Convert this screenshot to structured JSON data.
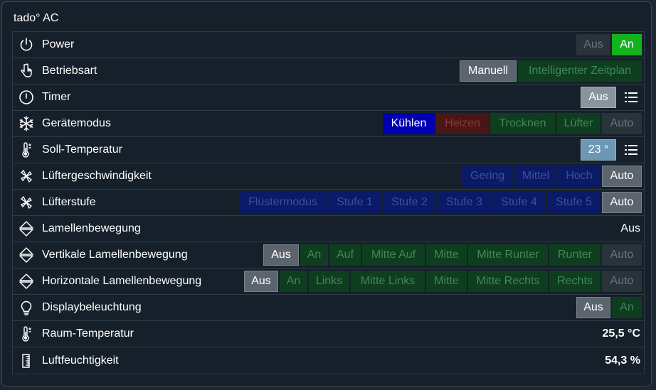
{
  "panel": {
    "title": "tado° AC"
  },
  "rows": {
    "power": {
      "label": "Power",
      "icon": "power-icon",
      "buttons": [
        "Aus",
        "An"
      ]
    },
    "betriebsart": {
      "label": "Betriebsart",
      "icon": "hand-pointer-icon",
      "buttons": [
        "Manuell",
        "Intelligenter Zeitplan"
      ]
    },
    "timer": {
      "label": "Timer",
      "icon": "clock-icon",
      "buttons": [
        "Aus"
      ]
    },
    "geraetemodus": {
      "label": "Gerätemodus",
      "icon": "snowflake-icon",
      "buttons": [
        "Kühlen",
        "Heizen",
        "Trocknen",
        "Lüfter",
        "Auto"
      ]
    },
    "soll_temperatur": {
      "label": "Soll-Temperatur",
      "icon": "thermometer-icon",
      "buttons": [
        "23 °"
      ]
    },
    "luftergeschwindigkeit": {
      "label": "Lüftergeschwindigkeit",
      "icon": "fan-icon",
      "buttons": [
        "Gering",
        "Mittel",
        "Hoch",
        "Auto"
      ]
    },
    "lufterstufe": {
      "label": "Lüfterstufe",
      "icon": "fan-icon",
      "buttons": [
        "Flüstermodus",
        "Stufe 1",
        "Stufe 2",
        "Stufe 3",
        "Stufe 4",
        "Stufe 5",
        "Auto"
      ]
    },
    "lamellenbewegung": {
      "label": "Lamellenbewegung",
      "icon": "swing-icon",
      "value": "Aus"
    },
    "vertikale": {
      "label": "Vertikale Lamellenbewegung",
      "icon": "swing-icon",
      "buttons": [
        "Aus",
        "An",
        "Auf",
        "Mitte Auf",
        "Mitte",
        "Mitte Runter",
        "Runter",
        "Auto"
      ]
    },
    "horizontale": {
      "label": "Horizontale Lamellenbewegung",
      "icon": "swing-icon",
      "buttons": [
        "Aus",
        "An",
        "Links",
        "Mitte Links",
        "Mitte",
        "Mitte Rechts",
        "Rechts",
        "Auto"
      ]
    },
    "displaybeleuchtung": {
      "label": "Displaybeleuchtung",
      "icon": "lightbulb-icon",
      "buttons": [
        "Aus",
        "An"
      ]
    },
    "raum_temperatur": {
      "label": "Raum-Temperatur",
      "icon": "thermometer-icon",
      "value": "25,5 °C"
    },
    "luftfeuchtigkeit": {
      "label": "Luftfeuchtigkeit",
      "icon": "humidity-icon",
      "value": "54,3 %"
    }
  },
  "colors": {
    "active_green": "#12b31c",
    "active_blue": "#0000b3",
    "active_gray": "#5c656e",
    "setpoint_steel": "#6d97b5"
  }
}
